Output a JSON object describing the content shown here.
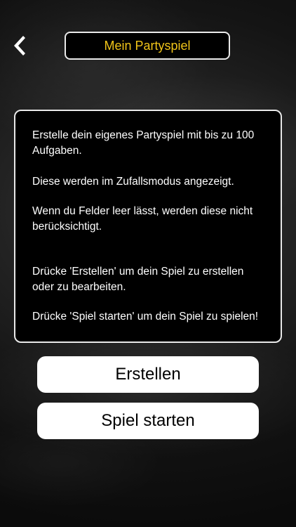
{
  "header": {
    "title": "Mein Partyspiel",
    "back_icon": "chevron-left-icon"
  },
  "info": {
    "paragraph1": "Erstelle dein eigenes Partyspiel mit bis zu 100 Aufgaben.",
    "paragraph2": "Diese werden im Zufallsmodus angezeigt.",
    "paragraph3": "Wenn du Felder leer lässt, werden diese nicht berücksichtigt.",
    "paragraph4": "Drücke 'Erstellen' um dein Spiel zu erstellen oder zu bearbeiten.",
    "paragraph5": "Drücke 'Spiel starten' um dein Spiel zu spielen!"
  },
  "buttons": {
    "create_label": "Erstellen",
    "start_label": "Spiel starten"
  },
  "colors": {
    "accent": "#f0c419",
    "background": "#1a1a1a",
    "button_bg": "#ffffff"
  }
}
